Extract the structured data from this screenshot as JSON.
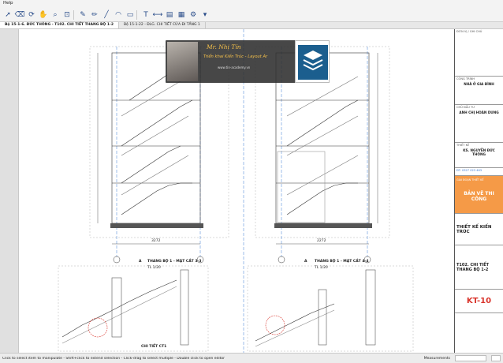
{
  "menubar": {
    "help": "Help"
  },
  "tabs": [
    {
      "label": "Bộ 15-1-6. ĐỨC THÔNG - T102. CHI TIẾT THANG BỘ 1-2"
    },
    {
      "label": "Bộ 15-1-22 - ĐLG. CHI TIẾT CỬA ĐI TẦNG 1"
    }
  ],
  "overlay": {
    "name": "Mr. Nhị Tín",
    "subtitle": "Triển khai Kiến Trúc - Layout Ar",
    "website": "www.tin-academy.vn"
  },
  "drawings": {
    "section33": "THANG BỘ 1 - MẶT CẮT 3-3",
    "section44": "THANG BỘ 1 - MẶT CẮT 4-4",
    "scale": "TL 1/20",
    "detail1": "CHI TIẾT CT1",
    "label_a": "A",
    "grid1": "1",
    "grid2": "2",
    "dim_3272": "3272",
    "dim_2272": "2272"
  },
  "titleblock": {
    "r1_label": "ĐƠN VỊ / GHI CHÚ",
    "r2_label": "CÔNG TRÌNH",
    "r2_value": "NHÀ Ở GIA ĐÌNH",
    "r3_label": "CHỦ ĐẦU TƯ",
    "r3_value": "ANH CHỊ HOÀN DUNG",
    "r4_label": "THIẾT KẾ",
    "r4_value": "KS. NGUYỄN ĐỨC THÔNG",
    "phone": "ĐT: 0327 023 463",
    "stage_label": "GIAI ĐOẠN THIẾT KẾ",
    "stage_value": "BẢN VẼ THI CÔNG",
    "category": "THIẾT KẾ KIẾN TRÚC",
    "drawing_title": "T102. CHI TIẾT THANG BỘ 1-2",
    "sheet_no": "KT-10"
  },
  "status": {
    "hint": "Click to select item to manipulate - Shift+click to extend selection - Click-drag to select multiple - Double click to open editor",
    "measurements": "Measurements"
  },
  "colors": {
    "accent_orange": "#f59a47",
    "red": "#d9342b",
    "overlay_gold": "#f5c04a"
  }
}
